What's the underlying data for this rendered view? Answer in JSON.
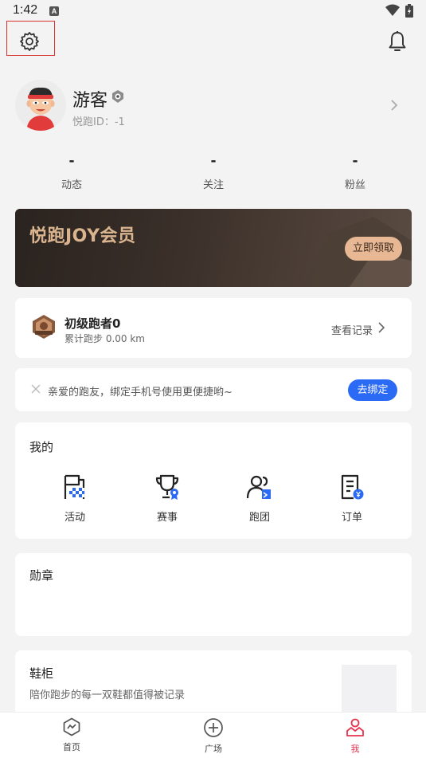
{
  "status_bar": {
    "time": "1:42",
    "a_icon": "A"
  },
  "header": {
    "settings_icon": "gear-icon",
    "notification_icon": "bell-icon"
  },
  "profile": {
    "username": "游客",
    "user_id": "悦跑ID：-1",
    "stats": [
      {
        "value": "-",
        "label": "动态"
      },
      {
        "value": "-",
        "label": "关注"
      },
      {
        "value": "-",
        "label": "粉丝"
      }
    ]
  },
  "member_banner": {
    "title": "悦跑JOY会员",
    "button": "立即领取"
  },
  "level": {
    "title": "初级跑者0",
    "subtitle": "累计跑步 0.00 km",
    "link": "查看记录"
  },
  "bind_phone": {
    "text": "亲爱的跑友，绑定手机号使用更便捷哟~",
    "button": "去绑定"
  },
  "mine": {
    "title": "我的",
    "items": [
      {
        "label": "活动",
        "icon": "flag-icon"
      },
      {
        "label": "赛事",
        "icon": "trophy-icon"
      },
      {
        "label": "跑团",
        "icon": "group-icon"
      },
      {
        "label": "订单",
        "icon": "order-icon"
      }
    ]
  },
  "medals": {
    "title": "勋章"
  },
  "shoe_cabinet": {
    "title": "鞋柜",
    "subtitle": "陪你跑步的每一双鞋都值得被记录"
  },
  "bottom_nav": [
    {
      "label": "首页",
      "icon": "home-icon"
    },
    {
      "label": "广场",
      "icon": "plus-circle-icon"
    },
    {
      "label": "我",
      "icon": "me-icon",
      "active": true
    }
  ],
  "colors": {
    "accent_blue": "#2a6af5",
    "active_red": "#e5344f",
    "banner_gold": "#d9b48f"
  }
}
